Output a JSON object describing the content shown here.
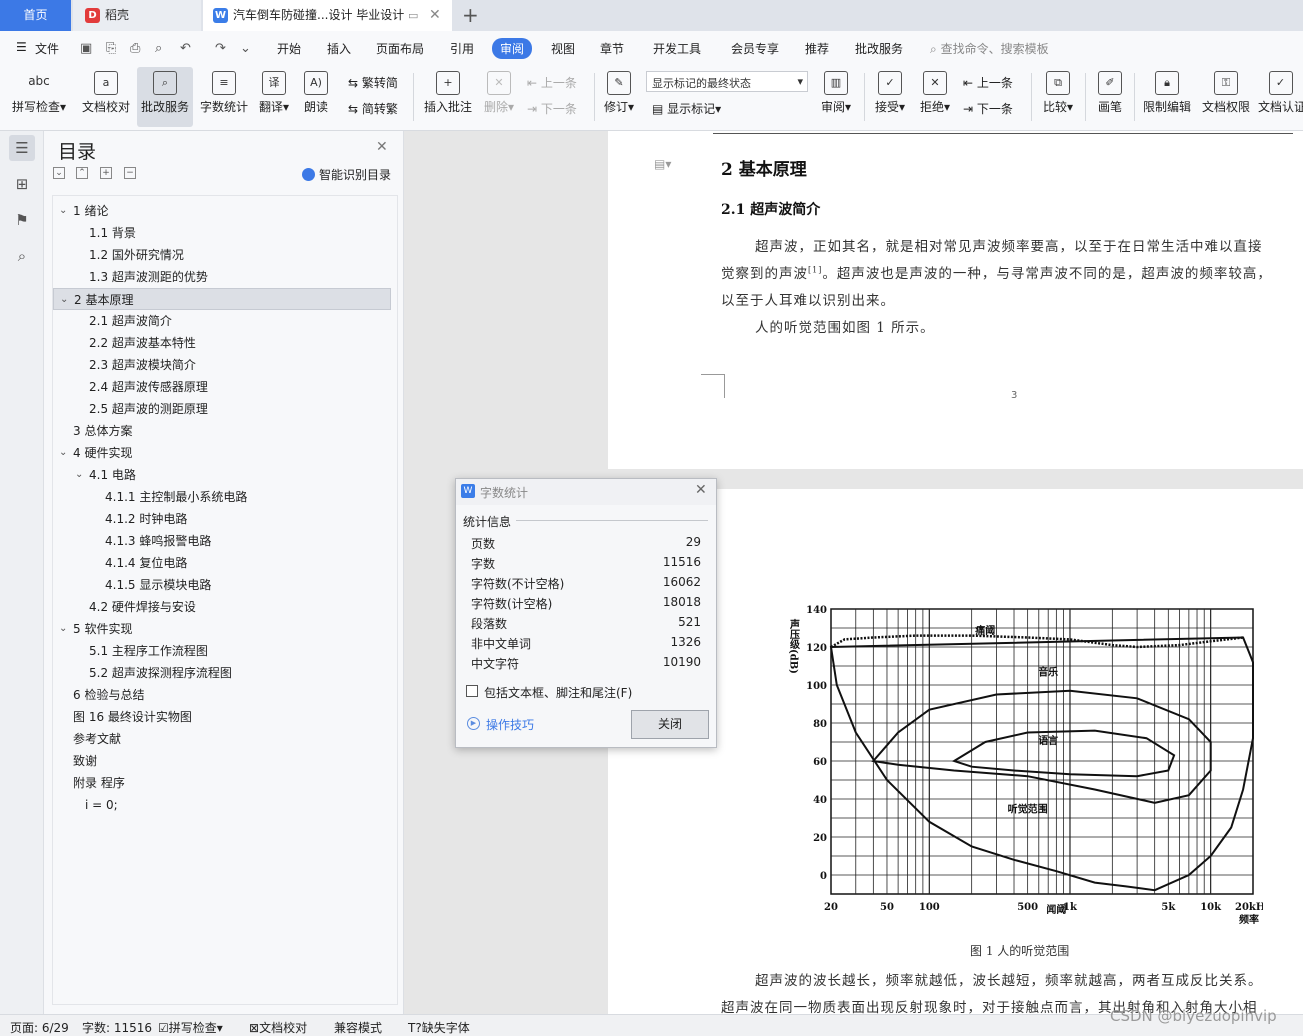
{
  "tabs": {
    "home": "首页",
    "daoke": "稻壳",
    "doc": "汽车倒车防碰撞...设计 毕业设计",
    "daoke_logo": "D",
    "doc_logo": "W"
  },
  "menu": {
    "file": "文件",
    "items": [
      "开始",
      "插入",
      "页面布局",
      "引用",
      "审阅",
      "视图",
      "章节",
      "开发工具",
      "会员专享",
      "推荐",
      "批改服务"
    ],
    "search": "查找命令、搜索模板"
  },
  "ribbon": {
    "spell_check": "拼写检查",
    "doc_proof": "文档校对",
    "review_service": "批改服务",
    "word_count": "字数统计",
    "translate": "翻译",
    "read_aloud": "朗读",
    "to_traditional": "繁转简",
    "to_simplified": "简转繁",
    "insert_comment": "插入批注",
    "delete": "删除",
    "prev_comment": "上一条",
    "next_comment": "下一条",
    "revise": "修订",
    "markup_state": "显示标记的最终状态",
    "show_markup": "显示标记",
    "review_pane": "审阅",
    "accept": "接受",
    "reject": "拒绝",
    "prev": "上一条",
    "next": "下一条",
    "compare": "比较",
    "pen": "画笔",
    "restrict_edit": "限制编辑",
    "doc_permission": "文档权限",
    "doc_cert": "文档认证"
  },
  "toc": {
    "title": "目录",
    "smart_label": "智能识别目录",
    "items": [
      {
        "label": "1  绪论",
        "arrow": "v"
      },
      {
        "label": "1.1  背景",
        "arrow": ""
      },
      {
        "label": "1.2  国外研究情况",
        "arrow": ""
      },
      {
        "label": "1.3  超声波测距的优势",
        "arrow": ""
      },
      {
        "label": "2  基本原理",
        "arrow": "v"
      },
      {
        "label": "2.1  超声波简介",
        "arrow": ""
      },
      {
        "label": "2.2  超声波基本特性",
        "arrow": ""
      },
      {
        "label": "2.3  超声波模块简介",
        "arrow": ""
      },
      {
        "label": "2.4  超声波传感器原理",
        "arrow": ""
      },
      {
        "label": "2.5  超声波的测距原理",
        "arrow": ""
      },
      {
        "label": "3  总体方案",
        "arrow": ""
      },
      {
        "label": "4  硬件实现",
        "arrow": "v"
      },
      {
        "label": "4.1  电路",
        "arrow": "v"
      },
      {
        "label": "4.1.1  主控制最小系统电路",
        "arrow": ""
      },
      {
        "label": "4.1.2  时钟电路",
        "arrow": ""
      },
      {
        "label": "4.1.3  蜂鸣报警电路",
        "arrow": ""
      },
      {
        "label": "4.1.4  复位电路",
        "arrow": ""
      },
      {
        "label": "4.1.5  显示模块电路",
        "arrow": ""
      },
      {
        "label": "4.2  硬件焊接与安设",
        "arrow": ""
      },
      {
        "label": "5  软件实现",
        "arrow": "v"
      },
      {
        "label": "5.1  主程序工作流程图",
        "arrow": ""
      },
      {
        "label": "5.2  超声波探测程序流程图",
        "arrow": ""
      },
      {
        "label": "6  检验与总结",
        "arrow": ""
      },
      {
        "label": "图 16  最终设计实物图",
        "arrow": ""
      },
      {
        "label": "参考文献",
        "arrow": ""
      },
      {
        "label": "致谢",
        "arrow": ""
      },
      {
        "label": "附录  程序",
        "arrow": ""
      },
      {
        "label": "i = 0;",
        "arrow": ""
      }
    ]
  },
  "document": {
    "chapter": "2  基本原理",
    "section": "2.1  超声波简介",
    "para1_line1": "超声波，正如其名，就是相对常见声波频率要高，以至于在日常生活中难以直接",
    "para1_line2a": "觉察到的声波",
    "para1_ref": "[1]",
    "para1_line2b": "。超声波也是声波的一种，与寻常声波不同的是，超声波的频率较高，",
    "para1_line3": "以至于人耳难以识别出来。",
    "para2": "人的听觉范围如图 1 所示。",
    "page_number": "3",
    "figure_caption": "图 1  人的听觉范围",
    "para3": "超声波的波长越长，频率就越低，波长越短，频率就越高，两者互成反比关系。",
    "para4": "超声波在同一物质表面出现反射现象时，对于接触点而言，其出射角和入射角大小相"
  },
  "chart_data": {
    "type": "area",
    "ylabel": "声压级(dB)",
    "xlabel": "频率",
    "x_ticks": [
      "20",
      "50",
      "100",
      "500",
      "1k",
      "5k",
      "10k",
      "20kHz"
    ],
    "y_ticks": [
      140,
      120,
      100,
      80,
      60,
      40,
      20,
      0
    ],
    "xlim_hz": [
      20,
      20000
    ],
    "ylim": [
      -10,
      140
    ],
    "x_scale": "log",
    "grid": true,
    "annotations": [
      "痛阈",
      "音乐",
      "语言",
      "听觉范围",
      "闻阈"
    ]
  },
  "dialog": {
    "title": "字数统计",
    "logo": "W",
    "section": "统计信息",
    "stats": [
      {
        "label": "页数",
        "value": "29"
      },
      {
        "label": "字数",
        "value": "11516"
      },
      {
        "label": "字符数(不计空格)",
        "value": "16062"
      },
      {
        "label": "字符数(计空格)",
        "value": "18018"
      },
      {
        "label": "段落数",
        "value": "521"
      },
      {
        "label": "非中文单词",
        "value": "1326"
      },
      {
        "label": "中文字符",
        "value": "10190"
      }
    ],
    "include_label": "包括文本框、脚注和尾注(F)",
    "tips": "操作技巧",
    "close": "关闭"
  },
  "status": {
    "page": "页面: 6/29",
    "words": "字数: 11516",
    "spell": "拼写检查",
    "proof": "文档校对",
    "compat": "兼容模式",
    "missing_font": "缺失字体"
  },
  "watermark": "CSDN @biyezuopinvip"
}
